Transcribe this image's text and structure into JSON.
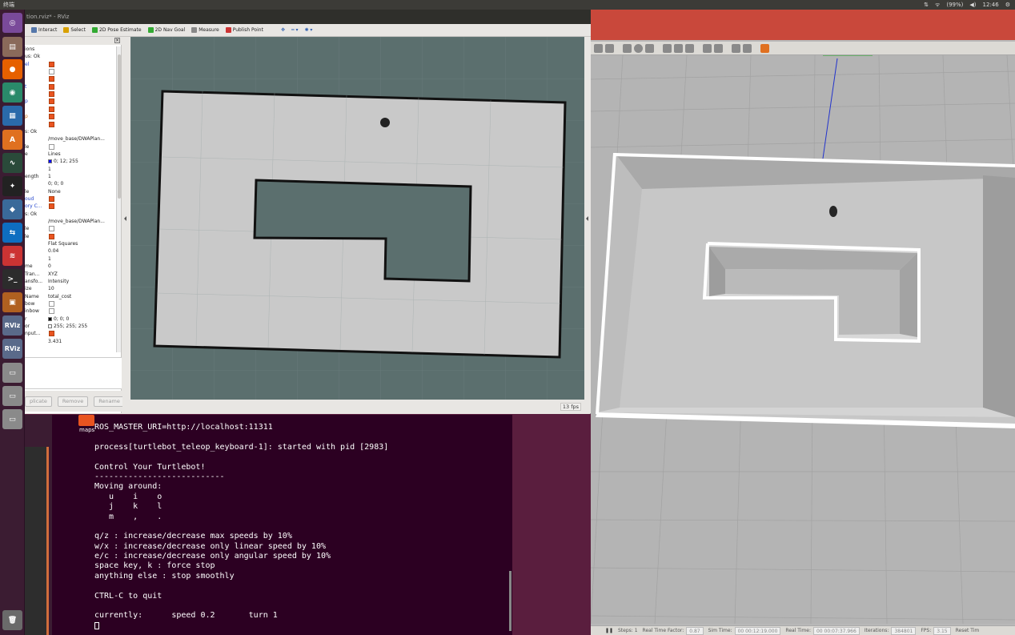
{
  "top_panel": {
    "app_title": "终端",
    "indicators": [
      "⇅",
      "ᯤ",
      "(99%)",
      "◀)",
      "12:46",
      "⚙"
    ]
  },
  "rviz": {
    "window_title": "tion.rviz* - RViz",
    "toolbar": [
      {
        "label": "Interact",
        "icon": "interact-icon",
        "color": "#5577aa"
      },
      {
        "label": "Select",
        "icon": "select-icon",
        "color": "#d8a000"
      },
      {
        "label": "2D Pose Estimate",
        "icon": "pose-estimate-icon",
        "color": "#33aa33"
      },
      {
        "label": "2D Nav Goal",
        "icon": "nav-goal-icon",
        "color": "#33aa33"
      },
      {
        "label": "Measure",
        "icon": "measure-icon",
        "color": "#888888"
      },
      {
        "label": "Publish Point",
        "icon": "publish-point-icon",
        "color": "#cc3333"
      }
    ],
    "displays": [
      {
        "key": "ions",
        "type": "text",
        "value": ""
      },
      {
        "key": "us: Ok",
        "type": "text",
        "value": ""
      },
      {
        "key": "el",
        "type": "check",
        "checked": true,
        "color": "blue"
      },
      {
        "key": "",
        "type": "check",
        "checked": false
      },
      {
        "key": "",
        "type": "check",
        "checked": true
      },
      {
        "key": "t",
        "type": "check",
        "checked": true,
        "color": "blue"
      },
      {
        "key": "",
        "type": "check",
        "checked": true
      },
      {
        "key": "p",
        "type": "check",
        "checked": true,
        "color": "blue"
      },
      {
        "key": "",
        "type": "check",
        "checked": true
      },
      {
        "key": "p",
        "type": "check",
        "checked": true,
        "color": "orange"
      },
      {
        "key": "",
        "type": "check",
        "checked": true
      },
      {
        "key": "s: Ok",
        "type": "text",
        "value": ""
      },
      {
        "key": "",
        "type": "text",
        "value": "/move_base/DWAPlan..."
      },
      {
        "key": "le",
        "type": "check",
        "checked": false
      },
      {
        "key": "e",
        "type": "text",
        "value": "Lines"
      },
      {
        "key": "",
        "type": "text",
        "value": "0; 12; 255",
        "swatch": "#0000ff"
      },
      {
        "key": "",
        "type": "text",
        "value": "1"
      },
      {
        "key": "ength",
        "type": "text",
        "value": "1"
      },
      {
        "key": "",
        "type": "text",
        "value": "0; 0; 0"
      },
      {
        "key": "le",
        "type": "text",
        "value": "None"
      },
      {
        "key": "oud",
        "type": "check",
        "checked": true,
        "color": "blue"
      },
      {
        "key": "ory C...",
        "type": "check",
        "checked": true,
        "color": "blue"
      },
      {
        "key": "s: Ok",
        "type": "text",
        "value": ""
      },
      {
        "key": "",
        "type": "text",
        "value": "/move_base/DWAPlan..."
      },
      {
        "key": "le",
        "type": "check",
        "checked": false
      },
      {
        "key": "le",
        "type": "check",
        "checked": true
      },
      {
        "key": "",
        "type": "text",
        "value": "Flat Squares"
      },
      {
        "key": "",
        "type": "text",
        "value": "0.04"
      },
      {
        "key": "",
        "type": "text",
        "value": "1"
      },
      {
        "key": "me",
        "type": "text",
        "value": "0"
      },
      {
        "key": " Tran...",
        "type": "text",
        "value": "XYZ"
      },
      {
        "key": "ansfo...",
        "type": "text",
        "value": "Intensity"
      },
      {
        "key": "ize",
        "type": "text",
        "value": "10"
      },
      {
        "key": " Name",
        "type": "text",
        "value": "total_cost"
      },
      {
        "key": "bow",
        "type": "check",
        "checked": false
      },
      {
        "key": "inbow",
        "type": "check",
        "checked": false
      },
      {
        "key": "r",
        "type": "text",
        "value": "0; 0; 0",
        "swatch": "#000000"
      },
      {
        "key": "or",
        "type": "text",
        "value": "255; 255; 255",
        "swatch": "#ffffff"
      },
      {
        "key": "nput...",
        "type": "check",
        "checked": true
      },
      {
        "key": "",
        "type": "text",
        "value": "3.431"
      }
    ],
    "panel_buttons": [
      "plicate",
      "Remove",
      "Rename"
    ],
    "fps": "13 fps"
  },
  "terminal": {
    "desktop_icon_label": "maps",
    "lines": [
      "ROS_MASTER_URI=http://localhost:11311",
      "",
      "process[turtlebot_teleop_keyboard-1]: started with pid [2983]",
      "",
      "Control Your Turtlebot!",
      "---------------------------",
      "Moving around:",
      "   u    i    o",
      "   j    k    l",
      "   m    ,    .",
      "",
      "q/z : increase/decrease max speeds by 10%",
      "w/x : increase/decrease only linear speed by 10%",
      "e/c : increase/decrease only angular speed by 10%",
      "space key, k : force stop",
      "anything else : stop smoothly",
      "",
      "CTRL-C to quit",
      "",
      "currently:      speed 0.2       turn 1"
    ]
  },
  "gazebo": {
    "status": [
      {
        "label": "Steps: 1",
        "value": ""
      },
      {
        "label": "Real Time Factor:",
        "value": "0.87"
      },
      {
        "label": "Sim Time:",
        "value": "00 00:12:19.000"
      },
      {
        "label": "Real Time:",
        "value": "00 00:07:37.966"
      },
      {
        "label": "Iterations:",
        "value": "384801"
      },
      {
        "label": "FPS:",
        "value": "3.15"
      },
      {
        "label": "Reset Tim",
        "value": ""
      }
    ]
  },
  "launcher": {
    "apps": [
      {
        "name": "ubuntu-dash",
        "glyph": "◎",
        "color": "#7a4a9a"
      },
      {
        "name": "files",
        "glyph": "▤",
        "color": "#8a6a5a"
      },
      {
        "name": "firefox",
        "glyph": "●",
        "color": "#e66000"
      },
      {
        "name": "chromium",
        "glyph": "◉",
        "color": "#2a8a6a"
      },
      {
        "name": "writer",
        "glyph": "▦",
        "color": "#2a6aaa"
      },
      {
        "name": "software",
        "glyph": "A",
        "color": "#e07020"
      },
      {
        "name": "system-monitor",
        "glyph": "∿",
        "color": "#2a4a3a"
      },
      {
        "name": "qq",
        "glyph": "✦",
        "color": "#222222"
      },
      {
        "name": "android-studio",
        "glyph": "◆",
        "color": "#3a6a9a"
      },
      {
        "name": "teamviewer",
        "glyph": "⇆",
        "color": "#0e6ec0"
      },
      {
        "name": "document-viewer",
        "glyph": "≋",
        "color": "#cc3333"
      },
      {
        "name": "terminal",
        "glyph": ">_",
        "color": "#2c2c2c"
      },
      {
        "name": "gazebo",
        "glyph": "▣",
        "color": "#b06020"
      },
      {
        "name": "rviz-1",
        "glyph": "RViz",
        "color": "#5a6a8a"
      },
      {
        "name": "rviz-2",
        "glyph": "RViz",
        "color": "#5a6a8a"
      },
      {
        "name": "drive-1",
        "glyph": "▭",
        "color": "#8a8a8a"
      },
      {
        "name": "drive-2",
        "glyph": "▭",
        "color": "#8a8a8a"
      },
      {
        "name": "drive-3",
        "glyph": "▭",
        "color": "#8a8a8a"
      },
      {
        "name": "trash",
        "glyph": "🗑",
        "color": "#6a6a6a"
      }
    ]
  }
}
